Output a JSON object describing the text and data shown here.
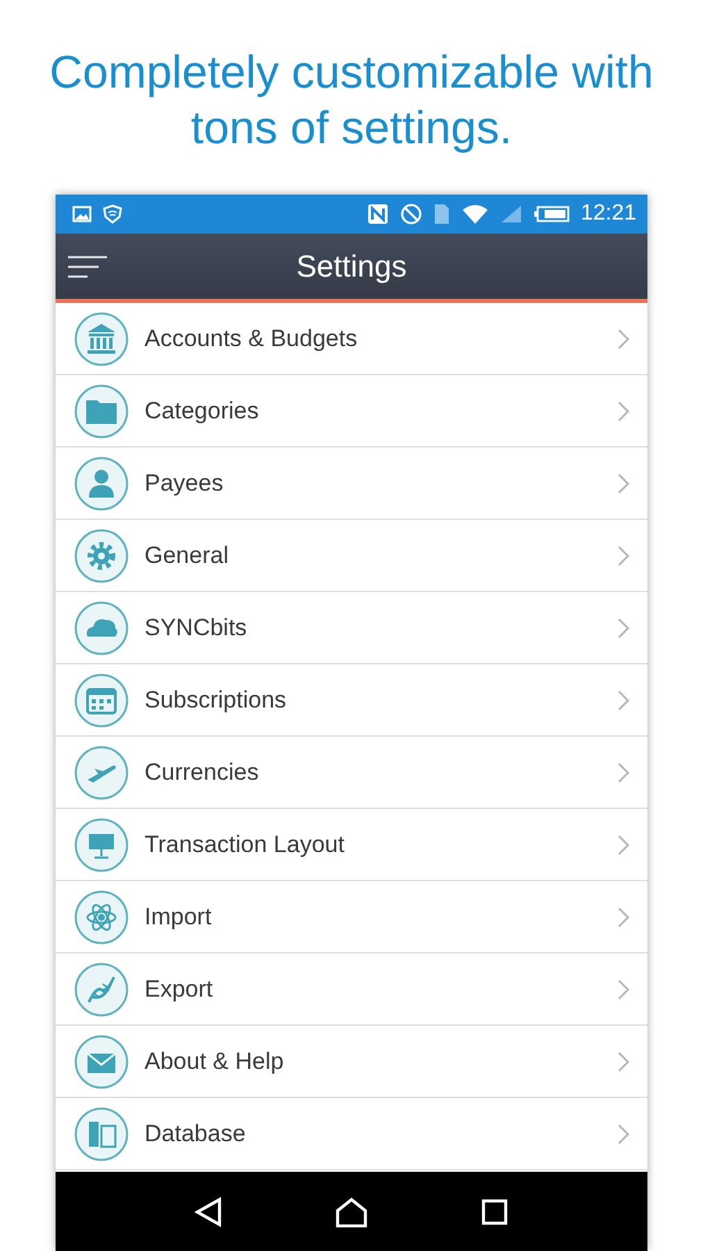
{
  "headline": "Completely customizable with tons of settings.",
  "status_bar": {
    "time": "12:21"
  },
  "app_bar": {
    "title": "Settings"
  },
  "items": [
    {
      "label": "Accounts & Budgets"
    },
    {
      "label": "Categories"
    },
    {
      "label": "Payees"
    },
    {
      "label": "General"
    },
    {
      "label": "SYNCbits"
    },
    {
      "label": "Subscriptions"
    },
    {
      "label": "Currencies"
    },
    {
      "label": "Transaction Layout"
    },
    {
      "label": "Import"
    },
    {
      "label": "Export"
    },
    {
      "label": "About & Help"
    },
    {
      "label": "Database"
    }
  ]
}
